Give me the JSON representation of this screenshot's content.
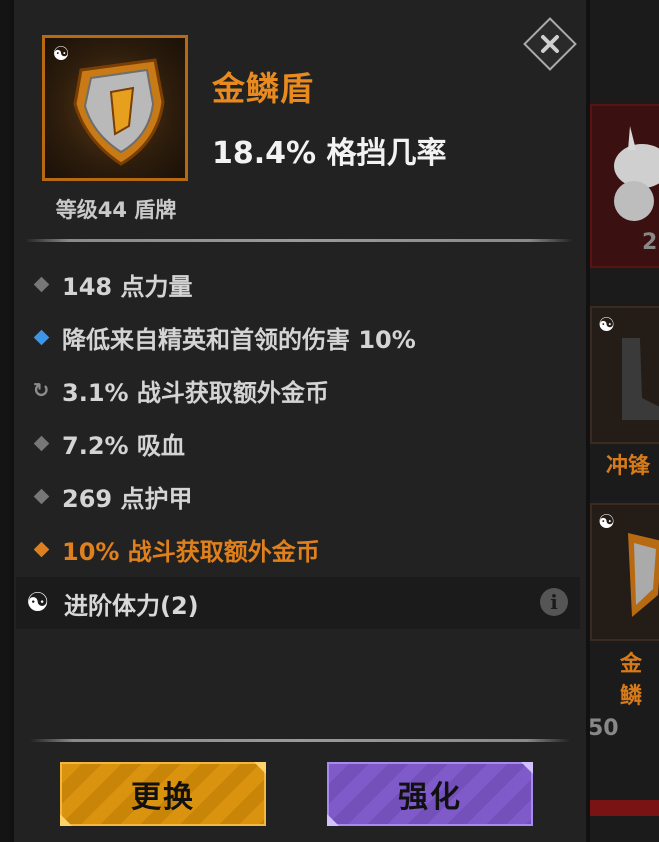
{
  "item": {
    "name": "金鳞盾",
    "main_stat": "18.4% 格挡几率",
    "level_type": "等级44 盾牌",
    "set_icon": "yin-yang-icon",
    "name_color": "#e98a1f"
  },
  "stats": [
    {
      "text": "148 点力量",
      "bullet": "diamond-gray"
    },
    {
      "text": "降低来自精英和首领的伤害 10%",
      "bullet": "diamond-blue"
    },
    {
      "text": "3.1% 战斗获取额外金币",
      "bullet": "refresh-icon"
    },
    {
      "text": "7.2% 吸血",
      "bullet": "diamond-gray"
    },
    {
      "text": "269 点护甲",
      "bullet": "diamond-gray"
    },
    {
      "text": "10% 战斗获取额外金币",
      "bullet": "diamond-orange"
    }
  ],
  "set_bonus": {
    "label": "进阶体力(2)",
    "info_icon": "i"
  },
  "buttons": {
    "replace": "更换",
    "enhance": "强化"
  },
  "background": {
    "card1_number": "2",
    "card2_label": "冲锋",
    "card3_label": "金鳞",
    "bottom_number": "50"
  },
  "colors": {
    "orange": "#e0801c",
    "blue": "#3d95e8",
    "replace_button": "#d9930f",
    "enhance_button": "#7f5ac9"
  }
}
